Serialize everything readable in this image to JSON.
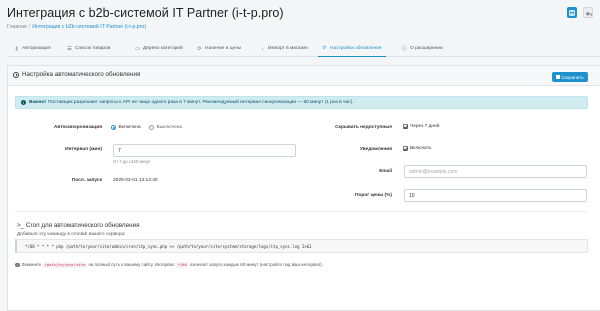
{
  "header": {
    "title": "Интеграция с b2b-системой IT Partner (i-t-p.pro)",
    "breadcrumb": [
      {
        "label": "Главная"
      },
      {
        "label": "Интеграция с b2b-системой IT Partner (i-t-p.pro)"
      }
    ],
    "save_icon": "save-icon",
    "back_icon": "reply-icon",
    "colors": {
      "accent": "#1e91cf"
    }
  },
  "tabs": [
    {
      "label": "Авторизация",
      "icon": "key-icon"
    },
    {
      "label": "Список товаров",
      "icon": "list-icon"
    },
    {
      "label": "Дерево категорий",
      "icon": "folder-icon"
    },
    {
      "label": "Наличие и цены",
      "icon": "sync-icon"
    },
    {
      "label": "Импорт в магазин",
      "icon": "download-icon"
    },
    {
      "label": "Настройка обновления",
      "icon": "refresh-icon",
      "active": true
    },
    {
      "label": "О расширении",
      "icon": "info-icon"
    }
  ],
  "panel": {
    "title": "Настройка автоматического обновления",
    "save_label": "Сохранить"
  },
  "alert": {
    "strong": "Важно!",
    "text": "Поставщик разрешает запросы к API не чаще одного раза в 7 минут. Рекомендуемый интервал синхронизации — 60 минут (1 раз в час)."
  },
  "form": {
    "autosync": {
      "label": "Автосинхронизация",
      "on_label": "Включена",
      "off_label": "Выключена",
      "selected": "Включена"
    },
    "interval": {
      "label": "Интервал (мин)",
      "value": "7",
      "help": "От 7 до 1440 минут"
    },
    "last_run": {
      "label": "Посл. запуск",
      "value": "2026-03-01 13:14:30"
    },
    "hide_unavailable": {
      "label": "Скрывать недоступные",
      "option": "Через 7 дней",
      "checked": true
    },
    "notifications": {
      "label": "Уведомления",
      "option": "Включить",
      "checked": true
    },
    "email": {
      "label": "Email",
      "value": "",
      "placeholder": "admin@example.com"
    },
    "price_threshold": {
      "label": "Порог цены (%)",
      "value": "10"
    }
  },
  "cron": {
    "title": ">_ Cron для автоматического обновления",
    "subtitle": "Добавьте эту команду в crontab вашего сервера:",
    "command": "*/60 * * * * php /path/to/your/site/admin/cron/itp_sync.php >> /path/to/your/site/system/storage/logs/itp_sync.log 2>&1",
    "note_prefix": "Замените",
    "note_code1": "/path/to/your/site",
    "note_mid": "на полный путь к вашему сайту. Интервал",
    "note_code2": "*/60",
    "note_suffix": "означает запуск каждые 60 минут (настройте под ваш интервал)."
  }
}
